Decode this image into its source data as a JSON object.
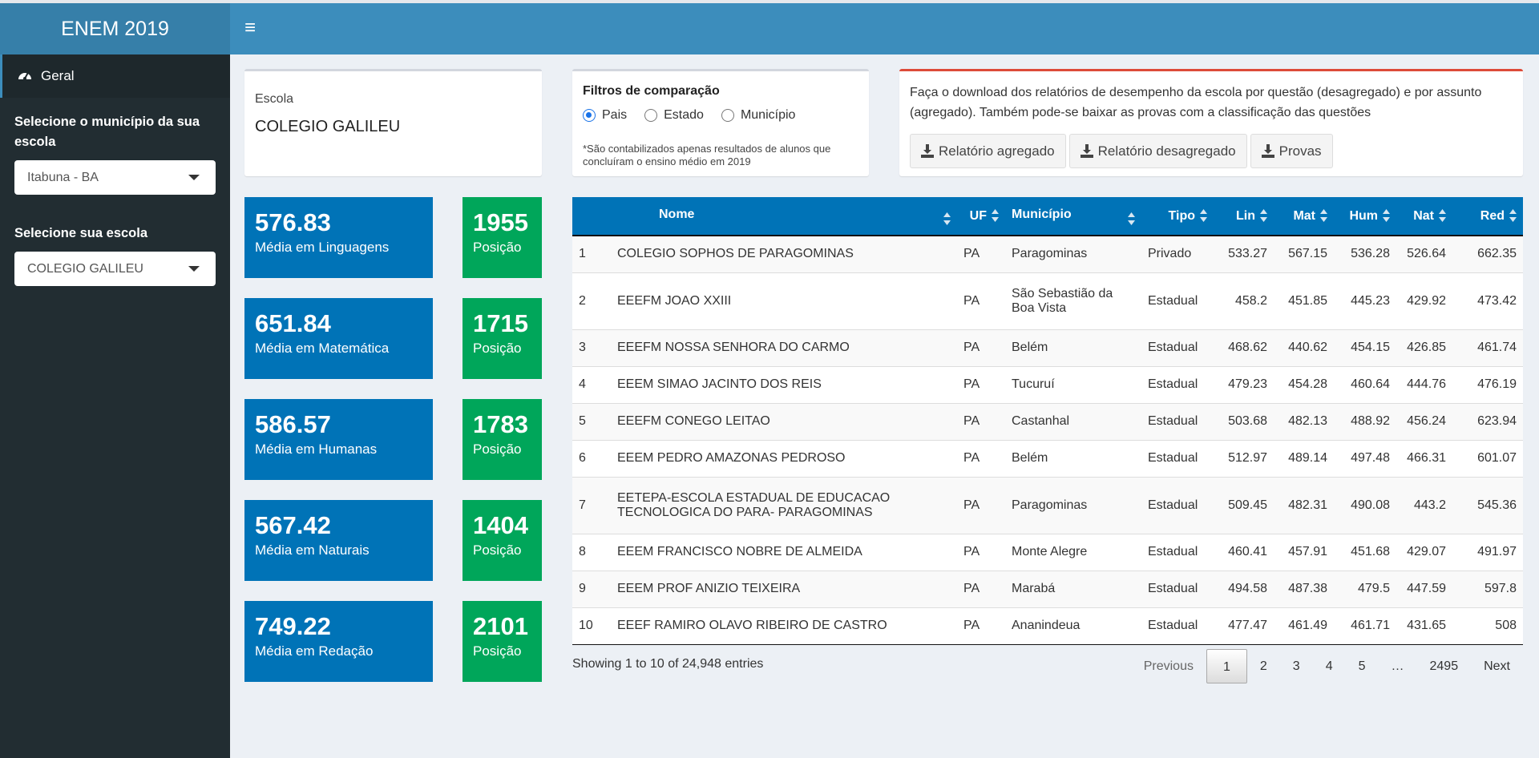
{
  "app": {
    "title": "ENEM 2019"
  },
  "sidebar": {
    "menu_item": "Geral",
    "municipio_label": "Selecione o município da sua escola",
    "municipio_value": "Itabuna - BA",
    "escola_label": "Selecione sua escola",
    "escola_value": "COLEGIO GALILEU"
  },
  "escola_box": {
    "label": "Escola",
    "name": "COLEGIO GALILEU"
  },
  "filtros": {
    "title": "Filtros de comparação",
    "options": [
      "Pais",
      "Estado",
      "Município"
    ],
    "selected": "Pais",
    "note": "*São contabilizados apenas resultados de alunos que concluíram o ensino médio em 2019"
  },
  "download": {
    "text": "Faça o download dos relatórios de desempenho da escola por questão (desagregado) e por assunto (agregado). Também pode-se baixar as provas com a classificação das questões",
    "buttons": [
      "Relatório agregado",
      "Relatório desagregado",
      "Provas"
    ],
    "accent": "#dd4b39"
  },
  "stats": [
    {
      "value": "576.83",
      "label": "Média em Linguagens",
      "position": "1955",
      "position_label": "Posição"
    },
    {
      "value": "651.84",
      "label": "Média em Matemática",
      "position": "1715",
      "position_label": "Posição"
    },
    {
      "value": "586.57",
      "label": "Média em Humanas",
      "position": "1783",
      "position_label": "Posição"
    },
    {
      "value": "567.42",
      "label": "Média em Naturais",
      "position": "1404",
      "position_label": "Posição"
    },
    {
      "value": "749.22",
      "label": "Média em Redação",
      "position": "2101",
      "position_label": "Posição"
    }
  ],
  "table": {
    "columns": [
      "",
      "Nome",
      "UF",
      "Município",
      "Tipo",
      "Lin",
      "Mat",
      "Hum",
      "Nat",
      "Red"
    ],
    "rows": [
      [
        "1",
        "COLEGIO SOPHOS DE PARAGOMINAS",
        "PA",
        "Paragominas",
        "Privado",
        "533.27",
        "567.15",
        "536.28",
        "526.64",
        "662.35"
      ],
      [
        "2",
        "EEEFM JOAO XXIII",
        "PA",
        "São Sebastião da Boa Vista",
        "Estadual",
        "458.2",
        "451.85",
        "445.23",
        "429.92",
        "473.42"
      ],
      [
        "3",
        "EEEFM NOSSA SENHORA DO CARMO",
        "PA",
        "Belém",
        "Estadual",
        "468.62",
        "440.62",
        "454.15",
        "426.85",
        "461.74"
      ],
      [
        "4",
        "EEEM SIMAO JACINTO DOS REIS",
        "PA",
        "Tucuruí",
        "Estadual",
        "479.23",
        "454.28",
        "460.64",
        "444.76",
        "476.19"
      ],
      [
        "5",
        "EEEFM CONEGO LEITAO",
        "PA",
        "Castanhal",
        "Estadual",
        "503.68",
        "482.13",
        "488.92",
        "456.24",
        "623.94"
      ],
      [
        "6",
        "EEEM PEDRO AMAZONAS PEDROSO",
        "PA",
        "Belém",
        "Estadual",
        "512.97",
        "489.14",
        "497.48",
        "466.31",
        "601.07"
      ],
      [
        "7",
        "EETEPA-ESCOLA ESTADUAL DE EDUCACAO TECNOLOGICA DO PARA- PARAGOMINAS",
        "PA",
        "Paragominas",
        "Estadual",
        "509.45",
        "482.31",
        "490.08",
        "443.2",
        "545.36"
      ],
      [
        "8",
        "EEEM FRANCISCO NOBRE DE ALMEIDA",
        "PA",
        "Monte Alegre",
        "Estadual",
        "460.41",
        "457.91",
        "451.68",
        "429.07",
        "491.97"
      ],
      [
        "9",
        "EEEM PROF ANIZIO TEIXEIRA",
        "PA",
        "Marabá",
        "Estadual",
        "494.58",
        "487.38",
        "479.5",
        "447.59",
        "597.8"
      ],
      [
        "10",
        "EEEF RAMIRO OLAVO RIBEIRO DE CASTRO",
        "PA",
        "Ananindeua",
        "Estadual",
        "477.47",
        "461.49",
        "461.71",
        "431.65",
        "508"
      ]
    ],
    "info": "Showing 1 to 10 of 24,948 entries"
  },
  "pagination": {
    "previous": "Previous",
    "pages": [
      "1",
      "2",
      "3",
      "4",
      "5",
      "…",
      "2495"
    ],
    "current": "1",
    "next": "Next"
  },
  "colors": {
    "header": "#3c8dbc",
    "logo": "#367fa9",
    "sidebar": "#222d32",
    "blue_box": "#0073b7",
    "green_box": "#00a65a"
  }
}
